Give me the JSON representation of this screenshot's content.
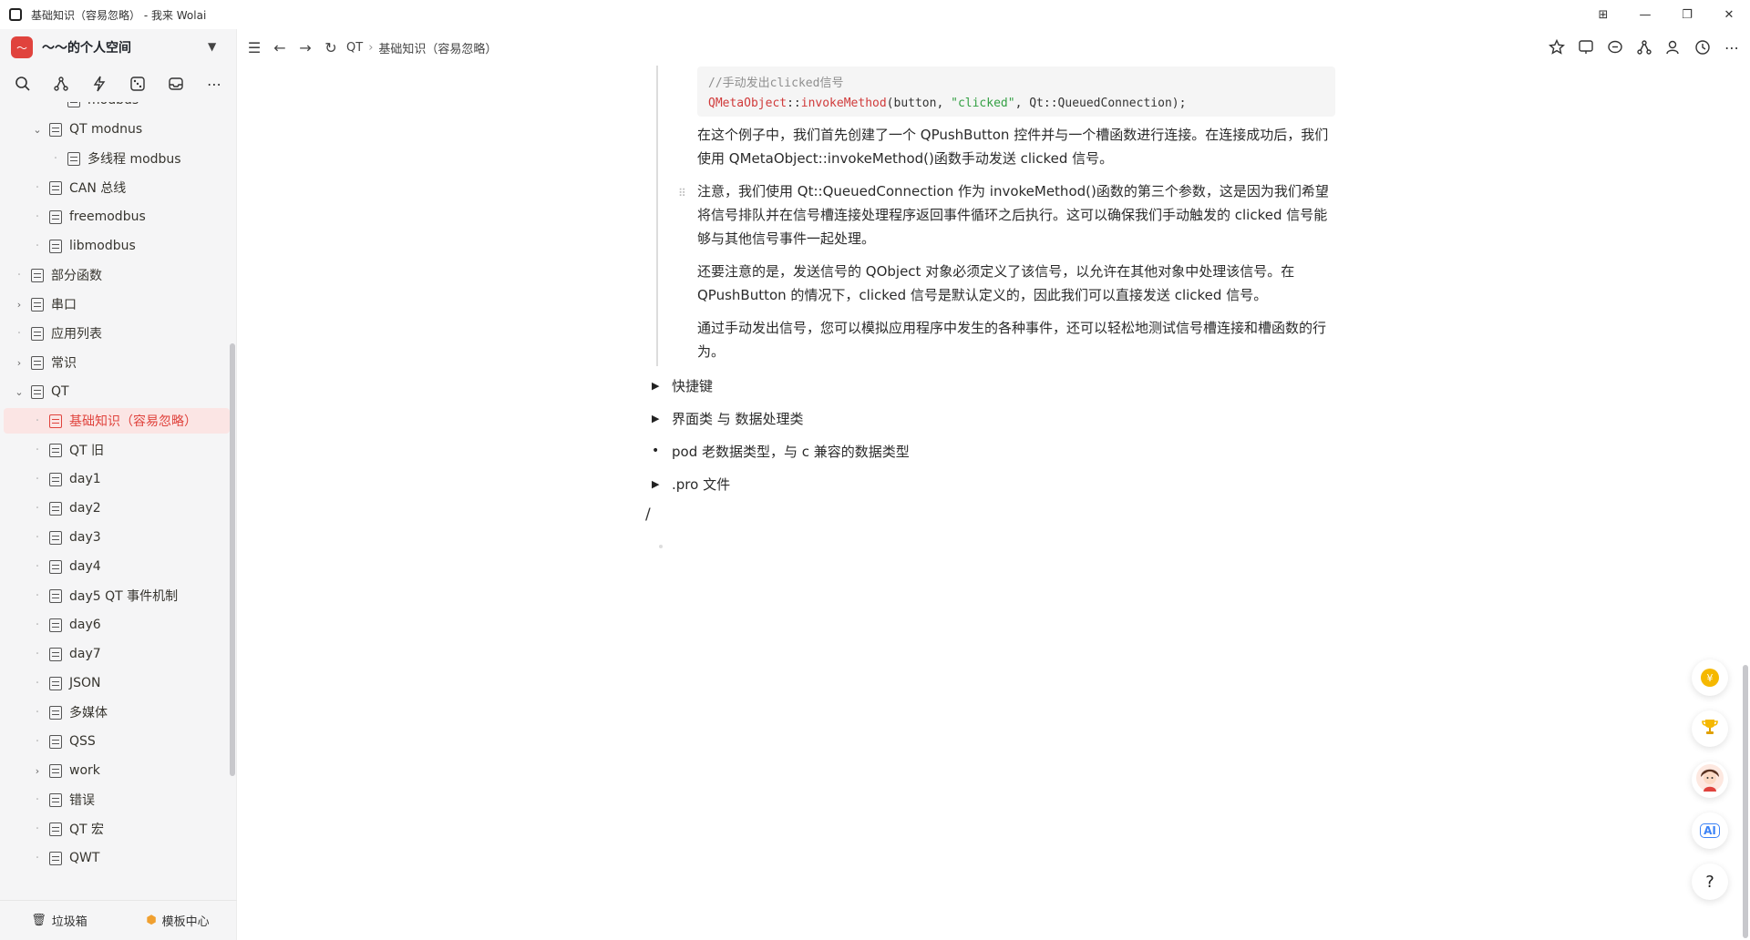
{
  "window": {
    "title": "基础知识（容易忽略） - 我来 Wolai",
    "controls": [
      "⊞",
      "—",
      "❐",
      "✕"
    ]
  },
  "workspace": {
    "name": "～～的个人空间",
    "logo_text": "～"
  },
  "sidebar": {
    "tree": [
      {
        "label": "modbus",
        "indent": 2,
        "kind": "dot"
      },
      {
        "label": "QT modnus",
        "indent": 1,
        "kind": "open"
      },
      {
        "label": "多线程 modbus",
        "indent": 2,
        "kind": "dot"
      },
      {
        "label": "CAN 总线",
        "indent": 1,
        "kind": "dot"
      },
      {
        "label": "freemodbus",
        "indent": 1,
        "kind": "dot"
      },
      {
        "label": "libmodbus",
        "indent": 1,
        "kind": "dot"
      },
      {
        "label": "部分函数",
        "indent": 0,
        "kind": "dot"
      },
      {
        "label": "串口",
        "indent": 0,
        "kind": "closed"
      },
      {
        "label": "应用列表",
        "indent": 0,
        "kind": "dot"
      },
      {
        "label": "常识",
        "indent": 0,
        "kind": "closed"
      },
      {
        "label": "QT",
        "indent": 0,
        "kind": "open"
      },
      {
        "label": "基础知识（容易忽略）",
        "indent": 1,
        "kind": "dot",
        "active": true
      },
      {
        "label": "QT 旧",
        "indent": 1,
        "kind": "dot"
      },
      {
        "label": "day1",
        "indent": 1,
        "kind": "dot"
      },
      {
        "label": "day2",
        "indent": 1,
        "kind": "dot"
      },
      {
        "label": "day3",
        "indent": 1,
        "kind": "dot"
      },
      {
        "label": "day4",
        "indent": 1,
        "kind": "dot"
      },
      {
        "label": "day5 QT 事件机制",
        "indent": 1,
        "kind": "dot"
      },
      {
        "label": "day6",
        "indent": 1,
        "kind": "dot"
      },
      {
        "label": "day7",
        "indent": 1,
        "kind": "dot"
      },
      {
        "label": "JSON",
        "indent": 1,
        "kind": "dot"
      },
      {
        "label": "多媒体",
        "indent": 1,
        "kind": "dot"
      },
      {
        "label": "QSS",
        "indent": 1,
        "kind": "dot"
      },
      {
        "label": "work",
        "indent": 1,
        "kind": "closed"
      },
      {
        "label": "错误",
        "indent": 1,
        "kind": "dot"
      },
      {
        "label": "QT 宏",
        "indent": 1,
        "kind": "dot"
      },
      {
        "label": "QWT",
        "indent": 1,
        "kind": "dot"
      }
    ],
    "trash_label": "垃圾箱",
    "template_label": "模板中心"
  },
  "breadcrumb": {
    "parent": "QT",
    "current": "基础知识（容易忽略）"
  },
  "code": {
    "comment": "//手动发出clicked信号",
    "cls": "QMetaObject",
    "sep1": "::",
    "method": "invokeMethod",
    "open": "(button, ",
    "str": "\"clicked\"",
    "rest": ", Qt::QueuedConnection);"
  },
  "paragraphs": [
    "在这个例子中，我们首先创建了一个 QPushButton 控件并与一个槽函数进行连接。在连接成功后，我们使用 QMetaObject::invokeMethod()函数手动发送 clicked 信号。",
    "注意，我们使用 Qt::QueuedConnection 作为 invokeMethod()函数的第三个参数，这是因为我们希望将信号排队并在信号槽连接处理程序返回事件循环之后执行。这可以确保我们手动触发的 clicked 信号能够与其他信号事件一起处理。",
    "还要注意的是，发送信号的 QObject 对象必须定义了该信号，以允许在其他对象中处理该信号。在 QPushButton 的情况下，clicked 信号是默认定义的，因此我们可以直接发送 clicked 信号。",
    "通过手动发出信号，您可以模拟应用程序中发生的各种事件，还可以轻松地测试信号槽连接和槽函数的行为。"
  ],
  "bullets": [
    {
      "marker": "▶",
      "text": "快捷键"
    },
    {
      "marker": "▶",
      "text": "界面类 与 数据处理类"
    },
    {
      "marker": "•",
      "text": "pod 老数据类型，与 c 兼容的数据类型"
    },
    {
      "marker": "▶",
      "text": ".pro 文件"
    }
  ],
  "slash_text": "/",
  "help_label": "?",
  "coin_label": "¥",
  "ai_label": "AI",
  "colors": {
    "accent": "#e0433d",
    "sidebar_bg": "#f5f5f6",
    "active_bg": "#fbe5e4"
  }
}
